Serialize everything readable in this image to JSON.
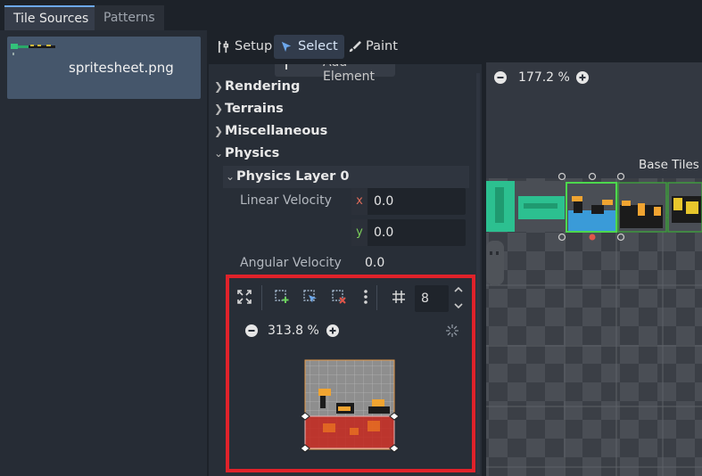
{
  "tabs": [
    {
      "label": "Tile Sources",
      "active": true
    },
    {
      "label": "Patterns",
      "active": false
    }
  ],
  "sources": {
    "items": [
      {
        "label": "spritesheet.png",
        "selected": true
      }
    ]
  },
  "modes": {
    "setup": "Setup",
    "select": "Select",
    "paint": "Paint"
  },
  "inspector": {
    "add_element": "Add Element",
    "sections": [
      "Rendering",
      "Terrains",
      "Miscellaneous",
      "Physics"
    ],
    "physics_layer": "Physics Layer 0",
    "linear_velocity": {
      "label": "Linear Velocity",
      "x_axis": "x",
      "x": "0.0",
      "y_axis": "y",
      "y": "0.0"
    },
    "angular_velocity": {
      "label": "Angular Velocity",
      "value": "0.0"
    }
  },
  "polygon_editor": {
    "grid_snap_value": "8",
    "zoom": "313.8 %"
  },
  "viewport": {
    "zoom": "177.2 %",
    "atlas_label": "Base Tiles"
  },
  "colors": {
    "accent": "#6da8ec",
    "highlight_frame": "#e0222a",
    "collision_fill": "#c4261c",
    "tile_selection": "#4dd84d"
  }
}
